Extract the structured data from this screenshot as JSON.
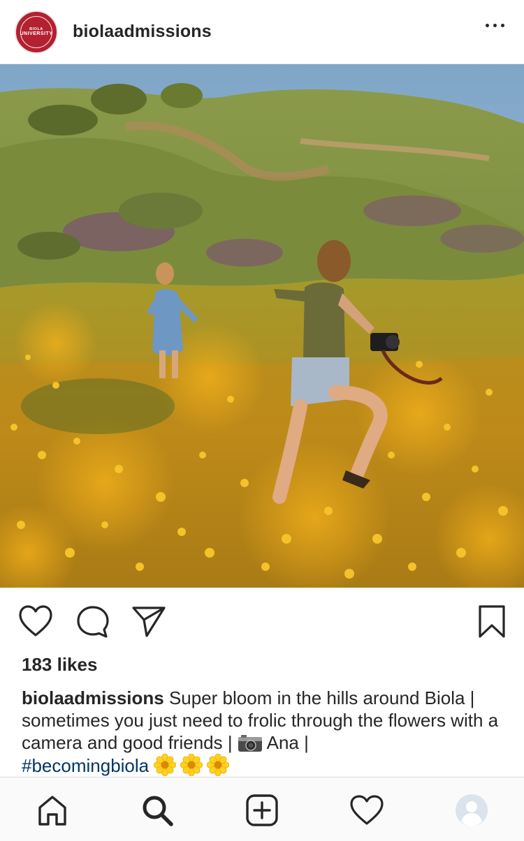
{
  "header": {
    "username": "biolaadmissions",
    "avatar_text_top": "BIOLA",
    "avatar_text_main": "UNIVERSITY",
    "more_icon": "more-horizontal-icon"
  },
  "post": {
    "image_icon": "photo",
    "likes_text": "183 likes",
    "caption": {
      "username": "biolaadmissions",
      "text_before_camera": " Super bloom in the hills around Biola | sometimes you just need to frolic through the flowers with a camera and good friends | ",
      "text_after_camera": " Ana | ",
      "hashtag": "#becomingbiola",
      "emojis": [
        "sunflower",
        "sunflower",
        "sunflower"
      ]
    }
  },
  "actions": {
    "like_icon": "heart-icon",
    "comment_icon": "comment-icon",
    "share_icon": "send-icon",
    "save_icon": "bookmark-icon"
  },
  "tabbar": {
    "items": [
      "home-icon",
      "search-icon",
      "new-post-icon",
      "activity-icon",
      "profile-icon"
    ]
  },
  "colors": {
    "text": "#262626",
    "hashtag": "#003569",
    "brand_red": "#b3202f"
  }
}
